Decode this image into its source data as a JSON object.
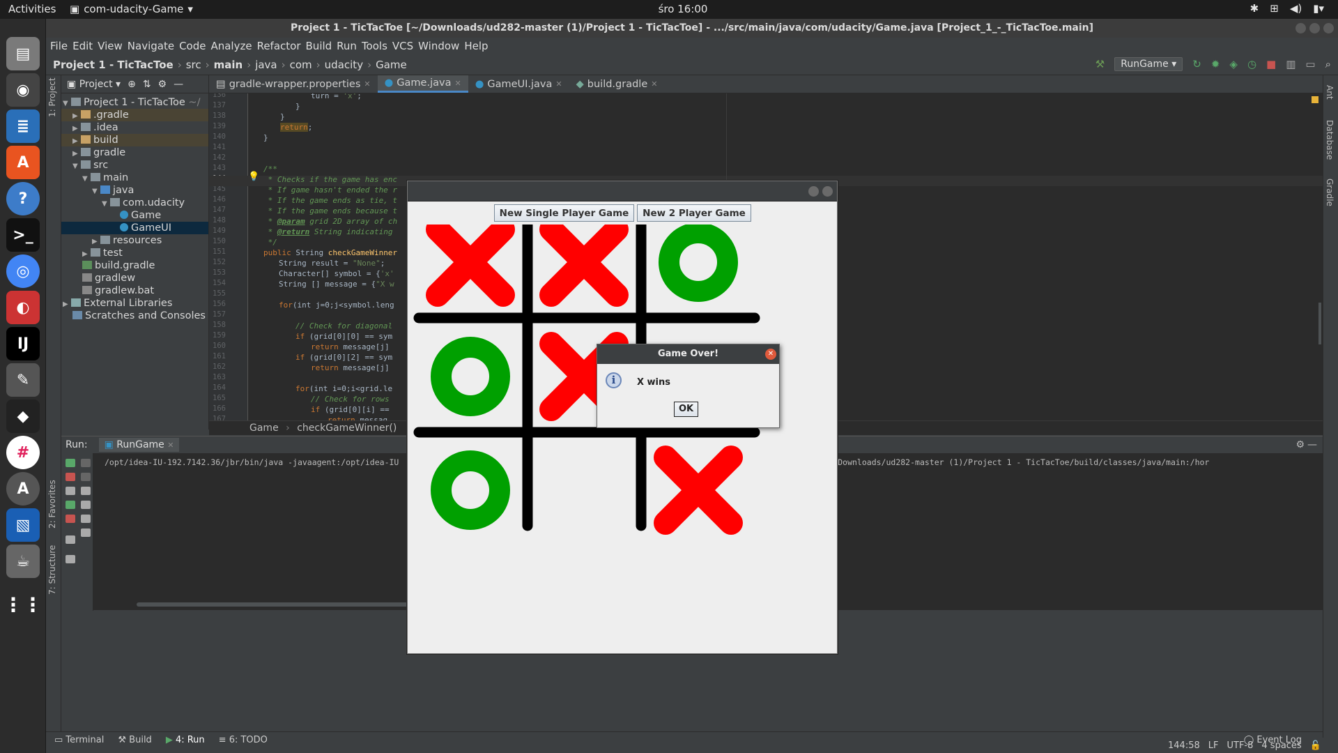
{
  "topbar": {
    "activities": "Activities",
    "app_name": "com-udacity-Game",
    "clock": "śro 16:00"
  },
  "ide": {
    "title": "Project 1 - TicTacToe [~/Downloads/ud282-master (1)/Project 1 - TicTacToe] - .../src/main/java/com/udacity/Game.java [Project_1_-_TicTacToe.main]",
    "menu": [
      "File",
      "Edit",
      "View",
      "Navigate",
      "Code",
      "Analyze",
      "Refactor",
      "Build",
      "Run",
      "Tools",
      "VCS",
      "Window",
      "Help"
    ],
    "breadcrumbs": [
      "Project 1 - TicTacToe",
      "src",
      "main",
      "java",
      "com",
      "udacity",
      "Game"
    ],
    "run_config": "RunGame",
    "left_tools": [
      "1: Project",
      "2: Favorites",
      "7: Structure"
    ],
    "right_tools": [
      "Ant",
      "Database",
      "Gradle"
    ],
    "project_header": "Project",
    "tree": [
      {
        "label": "Project 1 - TicTacToe",
        "suffix": "~/"
      },
      {
        "label": ".gradle"
      },
      {
        "label": ".idea"
      },
      {
        "label": "build"
      },
      {
        "label": "gradle"
      },
      {
        "label": "src"
      },
      {
        "label": "main"
      },
      {
        "label": "java"
      },
      {
        "label": "com.udacity"
      },
      {
        "label": "Game"
      },
      {
        "label": "GameUI"
      },
      {
        "label": "resources"
      },
      {
        "label": "test"
      },
      {
        "label": "build.gradle"
      },
      {
        "label": "gradlew"
      },
      {
        "label": "gradlew.bat"
      },
      {
        "label": "External Libraries"
      },
      {
        "label": "Scratches and Consoles"
      }
    ],
    "tabs": [
      "gradle-wrapper.properties",
      "Game.java",
      "GameUI.java",
      "build.gradle"
    ],
    "line_numbers": [
      "136",
      "137",
      "138",
      "139",
      "140",
      "141",
      "142",
      "143",
      "144",
      "145",
      "146",
      "147",
      "148",
      "149",
      "150",
      "151",
      "152",
      "153",
      "154",
      "155",
      "156",
      "157",
      "158",
      "159",
      "160",
      "161",
      "162",
      "163",
      "164",
      "165",
      "166",
      "167"
    ],
    "code": {
      "l136a": "turn = ",
      "l136b": "'x'",
      "l136c": ";",
      "l137": "}",
      "l138": "}",
      "l139": "return",
      "l139b": ";",
      "l140": "}",
      "l143": "/**",
      "l144": " * Checks if the game has enc",
      "l145": " * If game hasn't ended the r",
      "l146": " * If the game ends as tie, t",
      "l147": " * If the game ends because t",
      "l148a": " * ",
      "l148b": "@param",
      "l148c": " grid 2D array of ch",
      "l149a": " * ",
      "l149b": "@return",
      "l149c": " String indicating",
      "l150": " */",
      "l151a": "public ",
      "l151b": "String ",
      "l151c": "checkGameWinner",
      "l152a": "String result = ",
      "l152b": "\"None\"",
      "l152c": ";",
      "l153a": "Character[] symbol = {",
      "l153b": "'x'",
      "l154a": "String [] message = {",
      "l154b": "\"X w",
      "l156a": "for",
      "l156b": "(int j=0;j<symbol.leng",
      "l158": "// Check for diagonal",
      "l159a": "if ",
      "l159b": "(grid[0][0] == sym",
      "l160a": "return ",
      "l160b": "message[j]",
      "l161a": "if ",
      "l161b": "(grid[0][2] == sym",
      "l162a": "return ",
      "l162b": "message[j]",
      "l164a": "for",
      "l164b": "(int i=0;i<grid.le",
      "l165": "// Check for rows",
      "l166a": "if ",
      "l166b": "(grid[0][i] ==",
      "l167a": "return ",
      "l167b": "messag"
    },
    "editor_crumbs": [
      "Game",
      "checkGameWinner()"
    ],
    "run": {
      "label": "Run:",
      "tab": "RunGame",
      "console_left": "/opt/idea-IU-192.7142.36/jbr/bin/java -javaagent:/opt/idea-IU",
      "console_right": "lasspath \"/home/robert/Downloads/ud282-master (1)/Project 1 - TicTacToe/build/classes/java/main:/hor"
    },
    "bottom_tabs": [
      "Terminal",
      "Build",
      "4: Run",
      "6: TODO"
    ],
    "event_log": "Event Log",
    "status": {
      "position": "144:58",
      "line_sep": "LF",
      "encoding": "UTF-8",
      "indent": "4 spaces"
    }
  },
  "game": {
    "btn_single": "New Single Player Game",
    "btn_two": "New 2 Player Game",
    "board": [
      [
        "X",
        "X",
        "O"
      ],
      [
        "O",
        "X",
        ""
      ],
      [
        "O",
        "",
        "X"
      ]
    ],
    "colors": {
      "x": "#ff0000",
      "o": "#00a000",
      "grid": "#000000"
    }
  },
  "dialog": {
    "title": "Game Over!",
    "message": "X wins",
    "ok": "OK"
  }
}
